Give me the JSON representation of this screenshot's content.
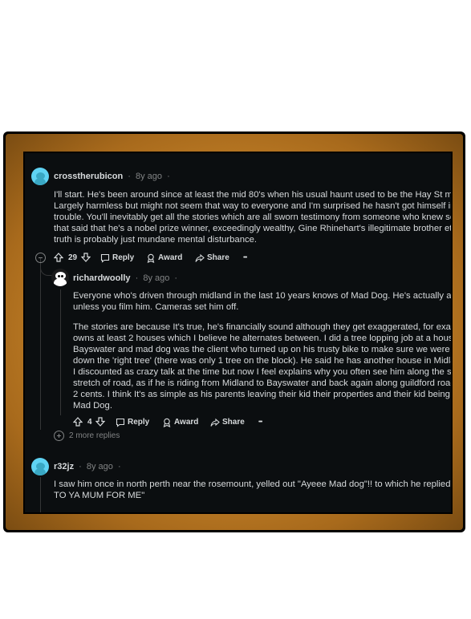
{
  "comments": [
    {
      "username": "crosstherubicon",
      "time": "8y ago",
      "body": [
        "I'll start. He's been around since at least the mid 80's when his usual haunt used to be the Hay St mall.",
        "Largely harmless but might not seem that way to everyone and I'm surprised he hasn't got himself into",
        "trouble. You'll inevitably get all the stories which are all sworn testimony from someone who knew someone",
        "that said that he's a nobel prize winner, exceedingly wealthy, Gine Rhinehart's illegitimate brother etc etc. The",
        "truth is probably just mundane mental disturbance."
      ],
      "votes": "29",
      "reply_label": "Reply",
      "award_label": "Award",
      "share_label": "Share",
      "more_label": "•••"
    },
    {
      "username": "richardwoolly",
      "time": "8y ago",
      "body": [
        "Everyone who's driven through midland in the last 10 years knows of Mad Dog. He's actually a nice bloke",
        "unless you film him. Cameras set him off.",
        "",
        "The stories are because It's true, he's financially sound although they get exaggerated, for example he",
        "owns at least 2 houses which I believe he alternates between. I did a tree lopping job at a house in",
        "Bayswater and mad dog was the client who turned up on his trusty bike to make sure we were cutting",
        "down the 'right tree' (there was only 1 tree on the block). He said he has another house in Midland which",
        "I discounted as crazy talk at the time but now I feel explains why you often see him along the same",
        "stretch of road, as if he is riding from Midland to Bayswater and back again along guildford road. Just my",
        "2 cents. I think It's as simple as his parents leaving their kid their properties and their kid being....well,",
        "Mad Dog."
      ],
      "votes": "4",
      "reply_label": "Reply",
      "award_label": "Award",
      "share_label": "Share",
      "more_label": "•••"
    },
    {
      "username": "r32jz",
      "time": "8y ago",
      "body": [
        "I saw him once in north perth near the rosemount, yelled out \"Ayeee Mad dog\"!! to which he replied \"SAY HI",
        "TO YA MUM FOR ME\""
      ]
    }
  ],
  "more_replies": "2 more replies",
  "colors": {
    "background": "#0b0e10",
    "text": "#d7dadc",
    "muted": "#818384",
    "avatar_teal": "#5fd3f3",
    "frame_gold": "#c8852a"
  }
}
